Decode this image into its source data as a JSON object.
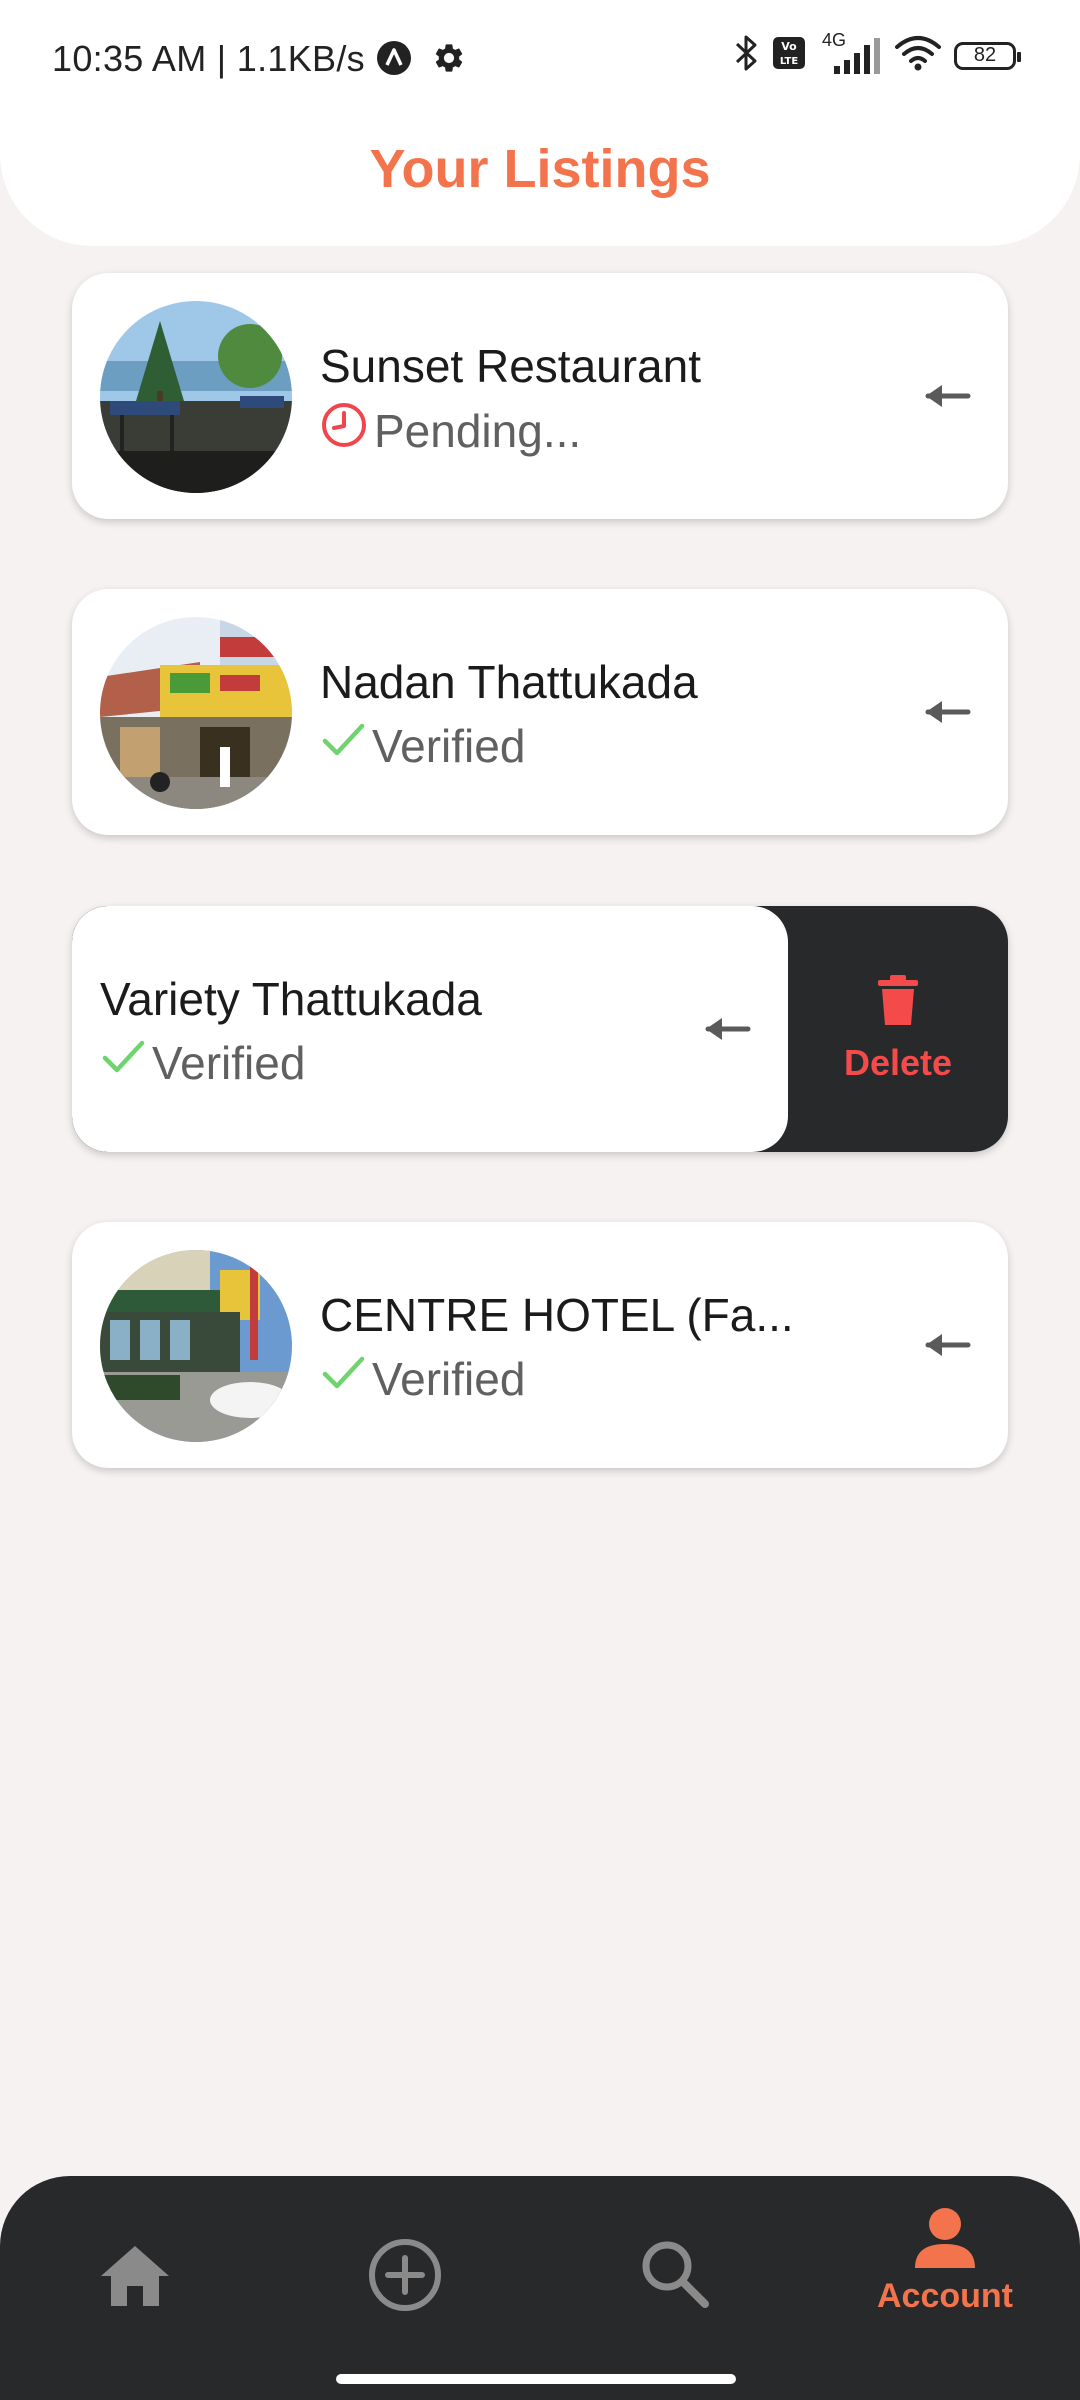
{
  "status_bar": {
    "time": "10:35 AM | 1.1KB/s",
    "network_type": "4G",
    "battery": "82"
  },
  "header": {
    "title": "Your Listings"
  },
  "listings": [
    {
      "name": "Sunset Restaurant",
      "status": "Pending...",
      "status_type": "pending"
    },
    {
      "name": "Nadan Thattukada",
      "status": "Verified",
      "status_type": "verified"
    },
    {
      "name": "Variety Thattukada",
      "status": "Verified",
      "status_type": "verified",
      "swipe_action": "Delete"
    },
    {
      "name": "CENTRE HOTEL (Fa...",
      "status": "Verified",
      "status_type": "verified"
    }
  ],
  "bottom_nav": {
    "items": [
      {
        "icon": "home-icon",
        "label": ""
      },
      {
        "icon": "add-circle-icon",
        "label": ""
      },
      {
        "icon": "search-icon",
        "label": ""
      },
      {
        "icon": "account-icon",
        "label": "Account"
      }
    ]
  },
  "colors": {
    "accent": "#f3744c",
    "verified": "#6fd46f",
    "pending": "#f0454c",
    "delete": "#f44a4a",
    "nav_bg": "#27292b",
    "page_bg": "#f6f2f1"
  }
}
